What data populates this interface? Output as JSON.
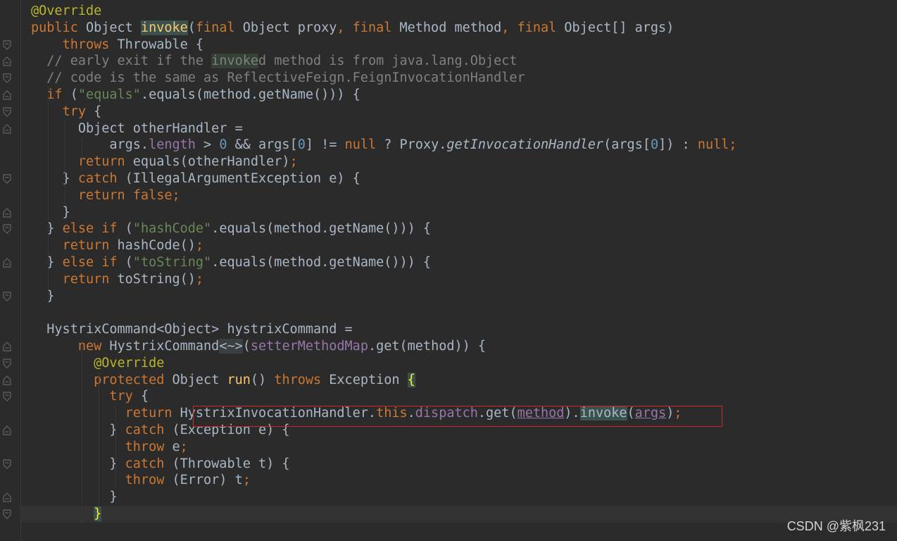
{
  "editor": {
    "lines": [
      [
        {
          "t": "@Override",
          "c": "ann"
        }
      ],
      [
        {
          "t": "public ",
          "c": "kw"
        },
        {
          "t": "Object "
        },
        {
          "t": "invoke",
          "c": "fn hl2"
        },
        {
          "t": "("
        },
        {
          "t": "final ",
          "c": "kw"
        },
        {
          "t": "Object proxy"
        },
        {
          "t": ", ",
          "c": "kw"
        },
        {
          "t": "final ",
          "c": "kw"
        },
        {
          "t": "Method method"
        },
        {
          "t": ", ",
          "c": "kw"
        },
        {
          "t": "final ",
          "c": "kw"
        },
        {
          "t": "Object[] args)"
        }
      ],
      [
        {
          "t": "    "
        },
        {
          "t": "throws ",
          "c": "kw"
        },
        {
          "t": "Throwable {"
        }
      ],
      [
        {
          "t": "  "
        },
        {
          "t": "// early exit if the ",
          "c": "cmt"
        },
        {
          "t": "invoke",
          "c": "cmt hl"
        },
        {
          "t": "d method is from java.lang.Object",
          "c": "cmt"
        }
      ],
      [
        {
          "t": "  "
        },
        {
          "t": "// code is the same as ReflectiveFeign.FeignInvocationHandler",
          "c": "cmt"
        }
      ],
      [
        {
          "t": "  "
        },
        {
          "t": "if ",
          "c": "kw"
        },
        {
          "t": "("
        },
        {
          "t": "\"equals\"",
          "c": "str"
        },
        {
          "t": ".equals(method.getName())) {"
        }
      ],
      [
        {
          "t": "    "
        },
        {
          "t": "try ",
          "c": "kw"
        },
        {
          "t": "{"
        }
      ],
      [
        {
          "t": "      Object otherHandler ="
        }
      ],
      [
        {
          "t": "          args."
        },
        {
          "t": "length",
          "c": "fld"
        },
        {
          "t": " > "
        },
        {
          "t": "0",
          "c": "num"
        },
        {
          "t": " && args["
        },
        {
          "t": "0",
          "c": "num"
        },
        {
          "t": "] != "
        },
        {
          "t": "null",
          "c": "kw"
        },
        {
          "t": " ? Proxy."
        },
        {
          "t": "getInvocationHandler",
          "c": "it"
        },
        {
          "t": "(args["
        },
        {
          "t": "0",
          "c": "num"
        },
        {
          "t": "]) : "
        },
        {
          "t": "null;",
          "c": "kw"
        }
      ],
      [
        {
          "t": "      "
        },
        {
          "t": "return ",
          "c": "kw"
        },
        {
          "t": "equals(otherHandler)"
        },
        {
          "t": ";",
          "c": "kw"
        }
      ],
      [
        {
          "t": "    } "
        },
        {
          "t": "catch ",
          "c": "kw"
        },
        {
          "t": "(IllegalArgumentException e) {"
        }
      ],
      [
        {
          "t": "      "
        },
        {
          "t": "return false;",
          "c": "kw"
        }
      ],
      [
        {
          "t": "    }"
        }
      ],
      [
        {
          "t": "  } "
        },
        {
          "t": "else if ",
          "c": "kw"
        },
        {
          "t": "("
        },
        {
          "t": "\"hashCode\"",
          "c": "str"
        },
        {
          "t": ".equals(method.getName())) {"
        }
      ],
      [
        {
          "t": "    "
        },
        {
          "t": "return ",
          "c": "kw"
        },
        {
          "t": "hashCode()"
        },
        {
          "t": ";",
          "c": "kw"
        }
      ],
      [
        {
          "t": "  } "
        },
        {
          "t": "else if ",
          "c": "kw"
        },
        {
          "t": "("
        },
        {
          "t": "\"toString\"",
          "c": "str"
        },
        {
          "t": ".equals(method.getName())) {"
        }
      ],
      [
        {
          "t": "    "
        },
        {
          "t": "return ",
          "c": "kw"
        },
        {
          "t": "toString()"
        },
        {
          "t": ";",
          "c": "kw"
        }
      ],
      [
        {
          "t": "  }"
        }
      ],
      [],
      [
        {
          "t": "  HystrixCommand<Object> hystrixCommand ="
        }
      ],
      [
        {
          "t": "      "
        },
        {
          "t": "new ",
          "c": "kw"
        },
        {
          "t": "HystrixCommand"
        },
        {
          "t": "<~>",
          "c": "dia"
        },
        {
          "t": "("
        },
        {
          "t": "setterMethodMap",
          "c": "fld"
        },
        {
          "t": ".get(method)) {"
        }
      ],
      [
        {
          "t": "        "
        },
        {
          "t": "@Override",
          "c": "ann"
        }
      ],
      [
        {
          "t": "        "
        },
        {
          "t": "protected ",
          "c": "kw"
        },
        {
          "t": "Object "
        },
        {
          "t": "run",
          "c": "fn"
        },
        {
          "t": "() "
        },
        {
          "t": "throws ",
          "c": "kw"
        },
        {
          "t": "Exception "
        },
        {
          "t": "{",
          "c": "brace-match"
        }
      ],
      [
        {
          "t": "          "
        },
        {
          "t": "try ",
          "c": "kw"
        },
        {
          "t": "{"
        }
      ],
      [
        {
          "t": "            "
        },
        {
          "t": "return ",
          "c": "kw"
        },
        {
          "t": "HystrixInvocationHandler."
        },
        {
          "t": "this",
          "c": "kw"
        },
        {
          "t": "."
        },
        {
          "t": "dispatch",
          "c": "fld"
        },
        {
          "t": ".get("
        },
        {
          "t": "method",
          "c": "fld ul"
        },
        {
          "t": ")."
        },
        {
          "t": "invoke",
          "c": "hl2"
        },
        {
          "t": "("
        },
        {
          "t": "args",
          "c": "fld ul"
        },
        {
          "t": ")"
        },
        {
          "t": ";",
          "c": "kw"
        }
      ],
      [
        {
          "t": "          } "
        },
        {
          "t": "catch ",
          "c": "kw"
        },
        {
          "t": "(Exception e) {"
        }
      ],
      [
        {
          "t": "            "
        },
        {
          "t": "throw ",
          "c": "kw"
        },
        {
          "t": "e"
        },
        {
          "t": ";",
          "c": "kw"
        }
      ],
      [
        {
          "t": "          } "
        },
        {
          "t": "catch ",
          "c": "kw"
        },
        {
          "t": "(Throwable t) {"
        }
      ],
      [
        {
          "t": "            "
        },
        {
          "t": "throw ",
          "c": "kw"
        },
        {
          "t": "(Error) t"
        },
        {
          "t": ";",
          "c": "kw"
        }
      ],
      [
        {
          "t": "          }"
        }
      ],
      [
        {
          "t": "        "
        },
        {
          "t": "}",
          "c": "brace-match"
        }
      ]
    ],
    "current_line_index": 30,
    "fold_marker_lines": [
      2,
      3,
      4,
      5,
      6,
      7,
      10,
      12,
      13,
      15,
      17,
      20,
      21,
      22,
      23,
      25,
      27,
      29,
      30
    ]
  },
  "watermark": {
    "text": "CSDN @紫枫231"
  }
}
